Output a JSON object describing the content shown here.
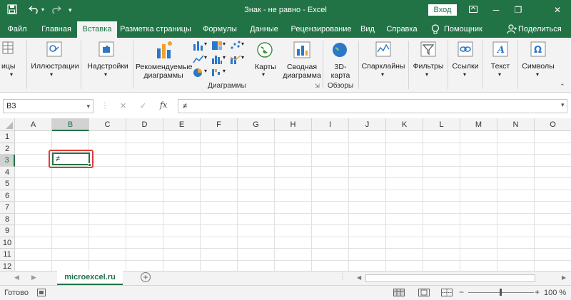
{
  "titlebar": {
    "title": "Знак - не равно  -  Excel",
    "login_label": "Вход",
    "save_icon": "save-icon",
    "undo_icon": "undo-icon",
    "redo_icon": "redo-icon"
  },
  "tabs": [
    {
      "label": "Файл"
    },
    {
      "label": "Главная"
    },
    {
      "label": "Вставка",
      "active": true
    },
    {
      "label": "Разметка страницы"
    },
    {
      "label": "Формулы"
    },
    {
      "label": "Данные"
    },
    {
      "label": "Рецензирование"
    },
    {
      "label": "Вид"
    },
    {
      "label": "Справка"
    },
    {
      "label": "Помощник"
    },
    {
      "label": "Поделиться"
    }
  ],
  "ribbon": {
    "tables_label": "ицы",
    "illustrations_label": "Иллюстрации",
    "addins_label": "Надстройки",
    "recommended_charts_line1": "Рекомендуемые",
    "recommended_charts_line2": "диаграммы",
    "maps_label": "Карты",
    "pivot_chart_line1": "Сводная",
    "pivot_chart_line2": "диаграмма",
    "charts_group_label": "Диаграммы",
    "map3d_line1": "3D-",
    "map3d_line2": "карта",
    "tours_group_label": "Обзоры",
    "sparklines_label": "Спарклайны",
    "filters_label": "Фильтры",
    "links_label": "Ссылки",
    "text_label": "Текст",
    "symbols_label": "Символы"
  },
  "formula_bar": {
    "name_box": "B3",
    "cancel_symbol": "✕",
    "enter_symbol": "✓",
    "fx_label": "fx",
    "content": "≠"
  },
  "grid": {
    "columns": [
      "A",
      "B",
      "C",
      "D",
      "E",
      "F",
      "G",
      "H",
      "I",
      "J",
      "K",
      "L",
      "M",
      "N",
      "O"
    ],
    "rows": [
      "1",
      "2",
      "3",
      "4",
      "5",
      "6",
      "7",
      "8",
      "9",
      "10",
      "11",
      "12"
    ],
    "selected_column": "B",
    "selected_row": "3",
    "active_cell_value": "≠"
  },
  "sheets": {
    "tab_label": "microexcel.ru",
    "add_symbol": "+"
  },
  "statusbar": {
    "ready_label": "Готово",
    "zoom_label": "100 %",
    "zoom_minus": "−",
    "zoom_plus": "+"
  },
  "colors": {
    "accent": "#217346",
    "highlight": "#e53935"
  }
}
